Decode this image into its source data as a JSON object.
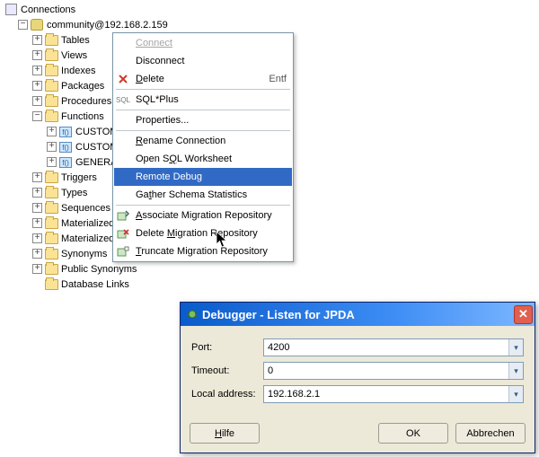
{
  "tree": {
    "root_label": "Connections",
    "conn_label": "community@192.168.2.159",
    "nodes": {
      "tables": "Tables",
      "views": "Views",
      "indexes": "Indexes",
      "packages": "Packages",
      "procedures": "Procedures",
      "functions": "Functions",
      "func_items": [
        "CUSTOM",
        "CUSTOM",
        "GENERA"
      ],
      "triggers": "Triggers",
      "types": "Types",
      "sequences": "Sequences",
      "mat1": "Materialized",
      "mat2": "Materialized",
      "synonyms": "Synonyms",
      "public_synonyms": "Public Synonyms",
      "db_links": "Database Links"
    }
  },
  "menu": {
    "connect": "Connect",
    "disconnect": "Disconnect",
    "delete_pre": "",
    "delete_mn": "D",
    "delete_post": "elete",
    "delete_shortcut": "Entf",
    "sqlplus": "SQL*Plus",
    "properties": "Properties...",
    "rename_pre": "",
    "rename_mn": "R",
    "rename_post": "ename Connection",
    "open_ws_pre": "Open S",
    "open_ws_mn": "Q",
    "open_ws_post": "L Worksheet",
    "remote_debug": "Remote Debug",
    "gather_pre": "Ga",
    "gather_mn": "t",
    "gather_post": "her Schema Statistics",
    "assoc_pre": "",
    "assoc_mn": "A",
    "assoc_post": "ssociate Migration Repository",
    "del_mig_pre": "Delete ",
    "del_mig_mn": "M",
    "del_mig_post": "igration Repository",
    "trunc_pre": "",
    "trunc_mn": "T",
    "trunc_post": "runcate Migration Repository"
  },
  "dialog": {
    "title": "Debugger - Listen for JPDA",
    "fields": {
      "port_label": "Port:",
      "port_value": "4200",
      "timeout_label": "Timeout:",
      "timeout_value": "0",
      "addr_label": "Local address:",
      "addr_value": "192.168.2.1"
    },
    "buttons": {
      "help_mn": "H",
      "help_post": "ilfe",
      "ok": "OK",
      "cancel": "Abbrechen"
    }
  }
}
